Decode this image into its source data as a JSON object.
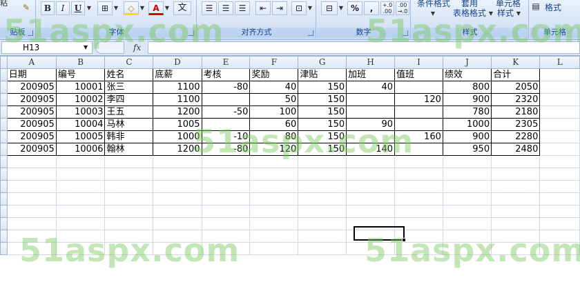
{
  "ribbon": {
    "groups": [
      {
        "label": "贴板"
      },
      {
        "label": "字体"
      },
      {
        "label": "对齐方式"
      },
      {
        "label": "数字"
      },
      {
        "label": "样式"
      },
      {
        "label": "单元格"
      }
    ],
    "font_buttons": {
      "bold": "B",
      "italic": "I",
      "underline": "U",
      "font_color": "A",
      "phonetic": "文"
    },
    "number_buttons": {
      "percent": "%",
      "comma": ",",
      "inc_decimal": "+.0 .00",
      "dec_decimal": ".00 →.0"
    },
    "styles": {
      "conditional": "条件格式",
      "table_format": "表格格式",
      "table_format_top": "套用",
      "cell_styles": "样式",
      "cell_styles_top": "单元格"
    },
    "cells": {
      "format": "格式"
    },
    "clipboard_top": "粘"
  },
  "formula_bar": {
    "name_box": "H13",
    "fx": "fx",
    "formula": ""
  },
  "columns": [
    "A",
    "B",
    "C",
    "D",
    "E",
    "F",
    "G",
    "H",
    "I",
    "J",
    "K",
    "L"
  ],
  "active_column": "H",
  "headers": [
    "日期",
    "编号",
    "姓名",
    "底薪",
    "考核",
    "奖励",
    "津贴",
    "加班",
    "值班",
    "绩效",
    "合计"
  ],
  "rows": [
    [
      "200905",
      "10001",
      "张三",
      "1100",
      "-80",
      "40",
      "150",
      "40",
      "",
      "800",
      "2050"
    ],
    [
      "200905",
      "10002",
      "李四",
      "1100",
      "",
      "50",
      "150",
      "",
      "120",
      "900",
      "2320"
    ],
    [
      "200905",
      "10003",
      "王五",
      "1200",
      "-50",
      "100",
      "150",
      "",
      "",
      "780",
      "2180"
    ],
    [
      "200905",
      "10004",
      "马林",
      "1005",
      "",
      "60",
      "150",
      "90",
      "",
      "1000",
      "2305"
    ],
    [
      "200905",
      "10005",
      "韩非",
      "1000",
      "-10",
      "80",
      "150",
      "",
      "160",
      "900",
      "2280"
    ],
    [
      "200905",
      "10006",
      "翰林",
      "1200",
      "-80",
      "120",
      "150",
      "140",
      "",
      "950",
      "2480"
    ]
  ],
  "watermark": "51aspx.com"
}
